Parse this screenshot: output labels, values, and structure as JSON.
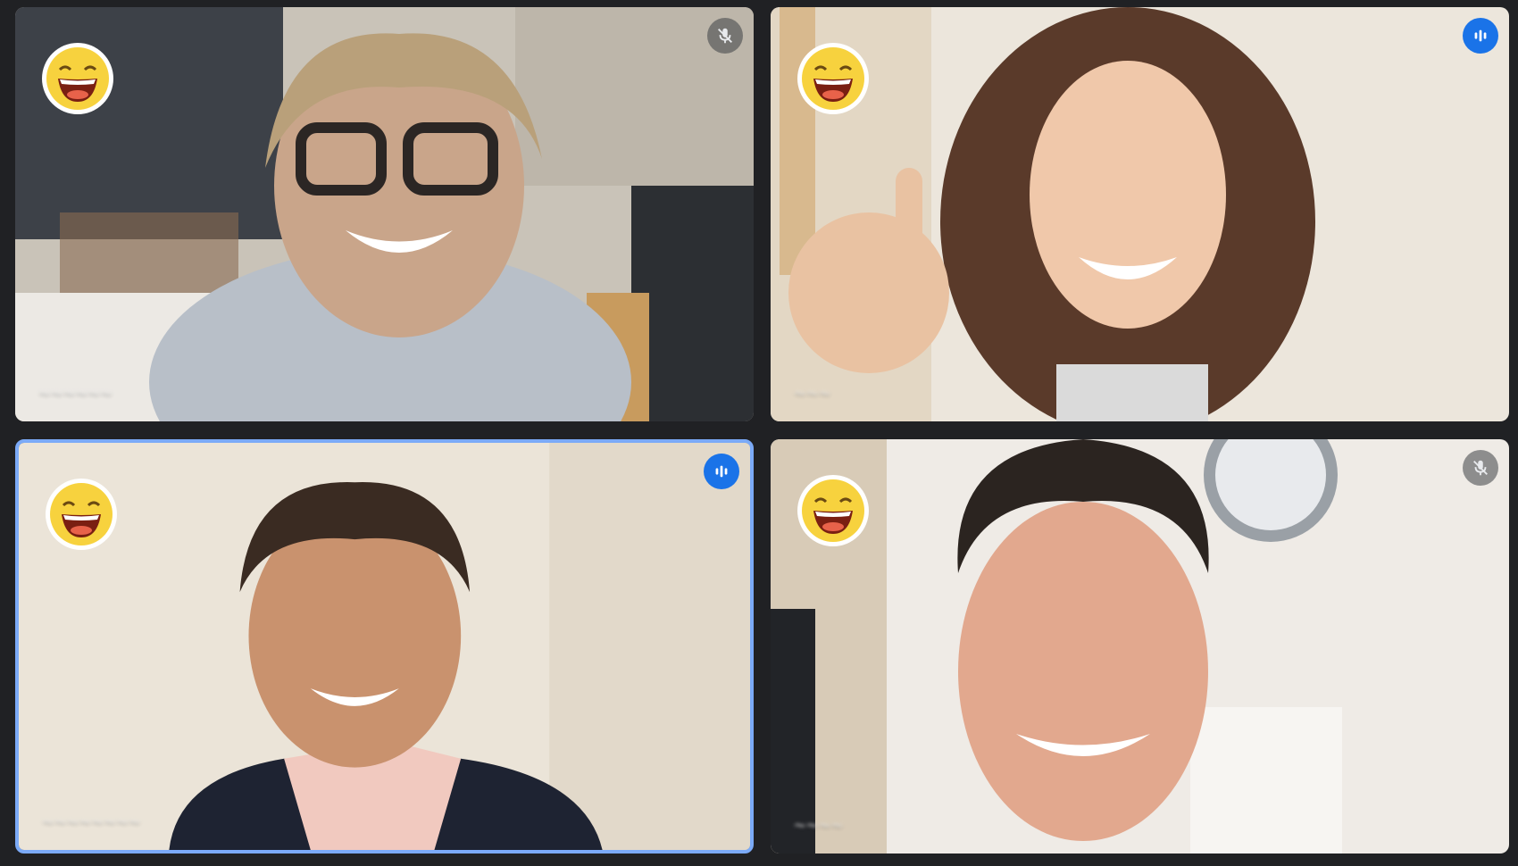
{
  "meeting": {
    "participants": [
      {
        "name": "~~~~~~",
        "reaction": "laughing-emoji-icon",
        "mic": "muted",
        "speaking": false
      },
      {
        "name": "~~~",
        "reaction": "laughing-emoji-icon",
        "mic": "active",
        "speaking": false
      },
      {
        "name": "~~~~~~~~",
        "reaction": "laughing-emoji-icon",
        "mic": "active",
        "speaking": true
      },
      {
        "name": "~~~~",
        "reaction": "laughing-emoji-icon",
        "mic": "muted",
        "speaking": false
      }
    ]
  },
  "colors": {
    "background": "#202124",
    "speaking_border": "#7baaf7",
    "mic_active": "#1a73e8"
  }
}
